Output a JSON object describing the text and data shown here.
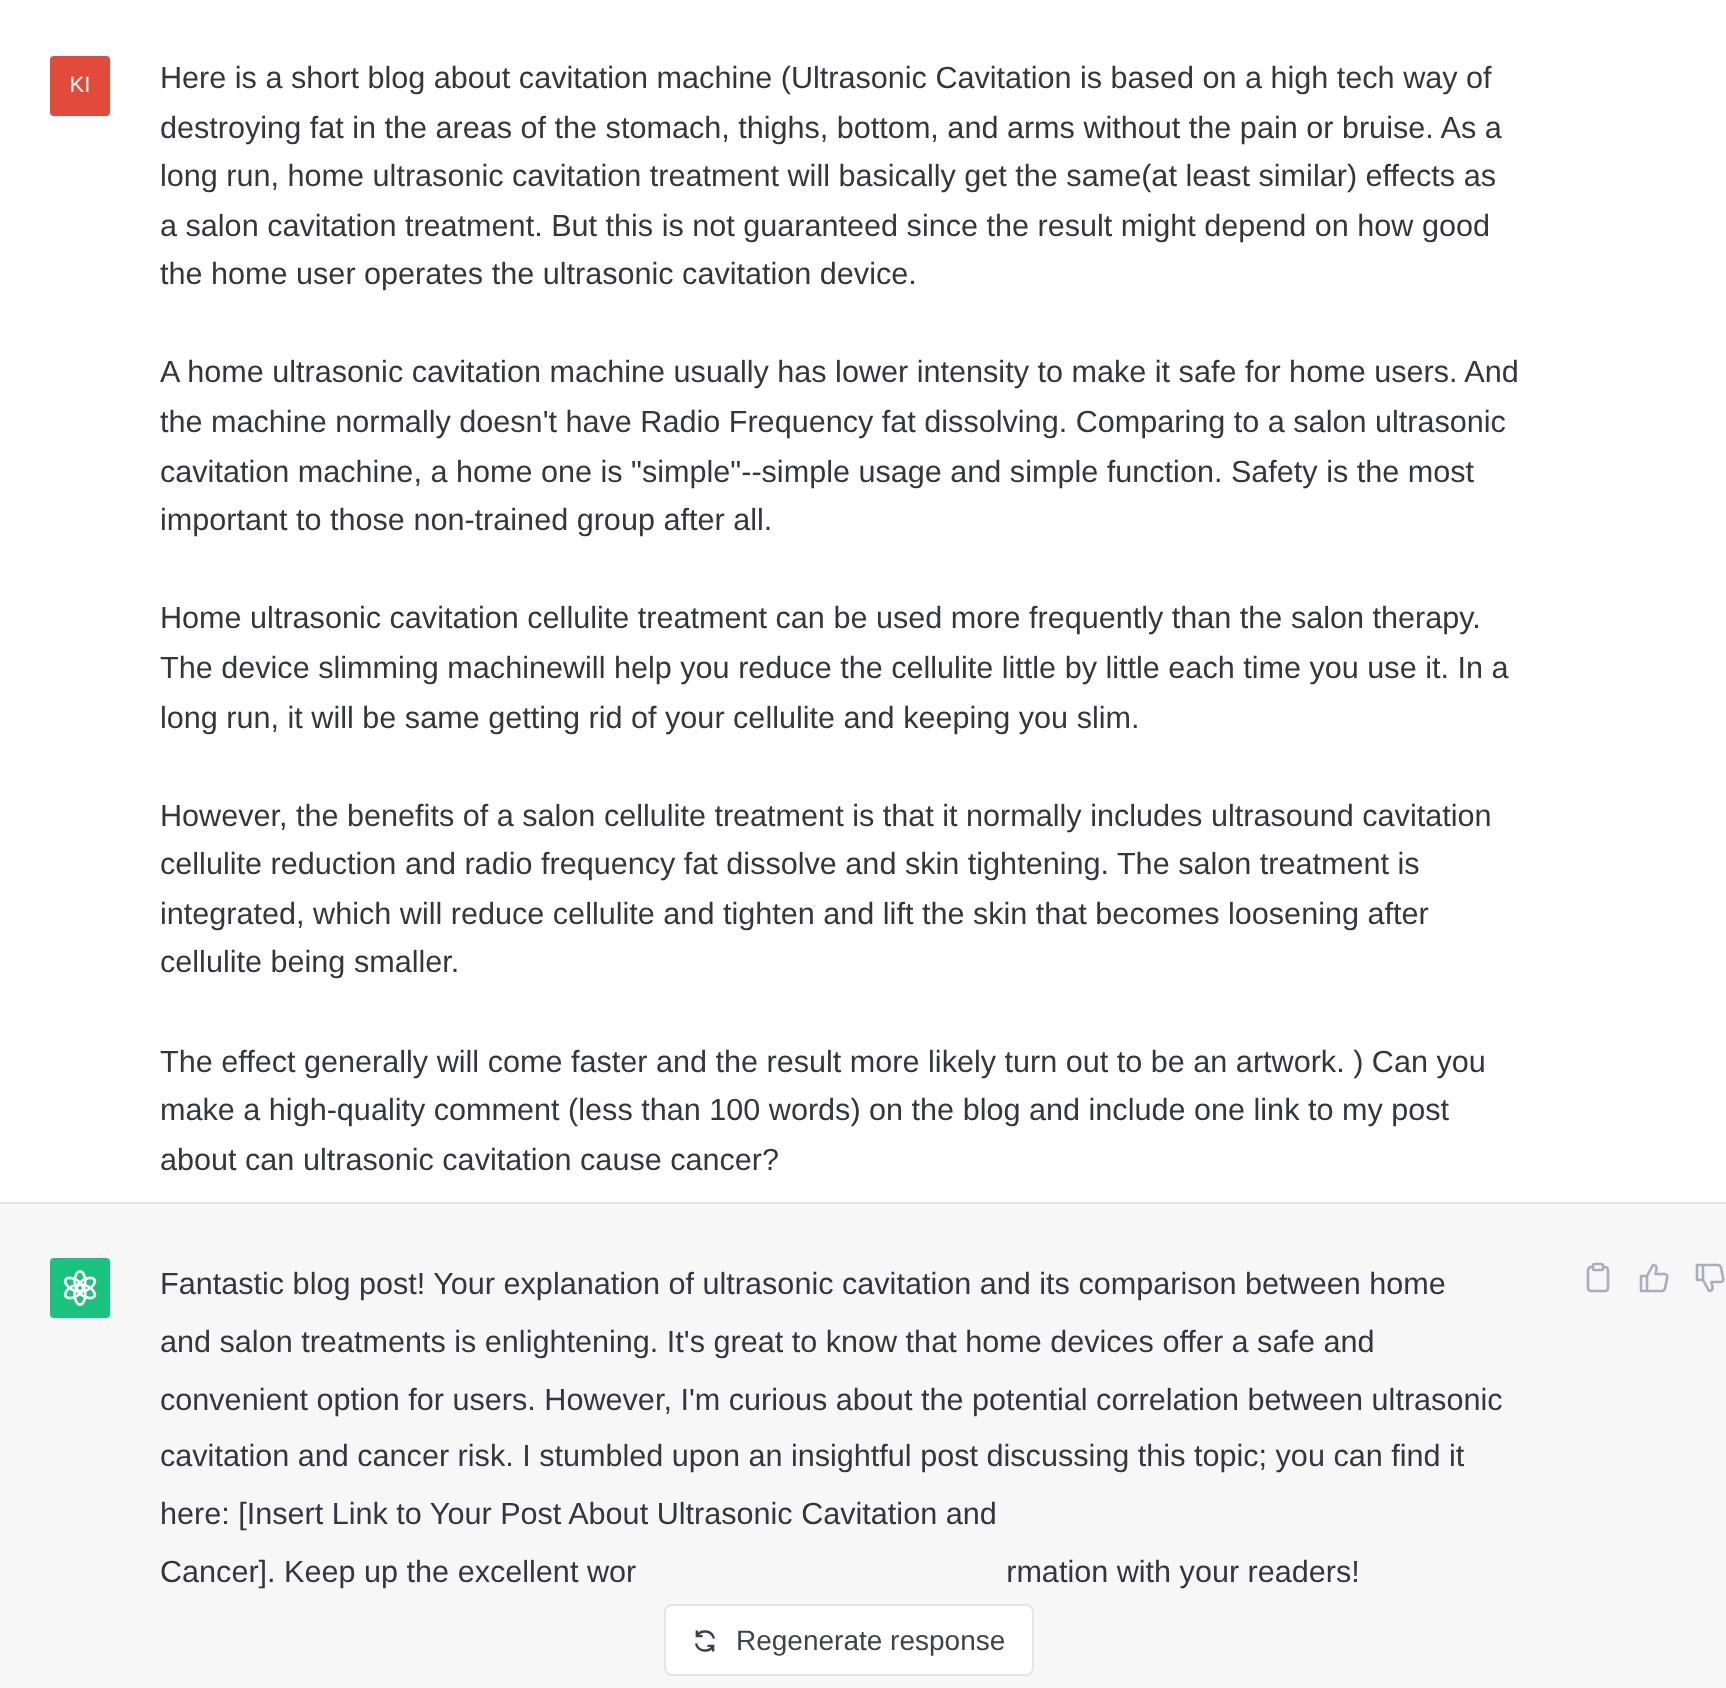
{
  "user_message": {
    "avatar": "KI",
    "paragraphs": [
      "Here is a short blog about cavitation machine (Ultrasonic Cavitation is based on a high tech way of destroying fat in the areas of the stomach, thighs, bottom, and arms without the pain or bruise. As a long run, home ultrasonic cavitation treatment will basically get the same(at least similar) effects as a salon cavitation treatment. But this is not guaranteed since the result might depend on how good the home user operates the ultrasonic cavitation device.",
      "A home ultrasonic cavitation machine usually has lower intensity to make it safe for home users. And the machine normally doesn't have Radio Frequency fat dissolving. Comparing to a salon ultrasonic cavitation machine, a home one is \"simple\"--simple usage and simple function. Safety is the most important to those non-trained group after all.",
      "Home ultrasonic cavitation cellulite treatment can be used more frequently than the salon therapy. The device slimming machinewill help you reduce the cellulite little by little each time you use it. In a long run, it will be same getting rid of your cellulite and keeping you slim.",
      "However, the benefits of a salon cellulite treatment is that it normally includes ultrasound cavitation cellulite reduction and radio frequency fat dissolve and skin tightening. The salon treatment is integrated, which will reduce cellulite and tighten and lift the skin that becomes loosening after cellulite being smaller.",
      "The effect generally will come faster and the result more likely turn out to be an artwork. ) Can you make a high-quality comment (less than 100 words) on the blog and include one link to my post about can ultrasonic cavitation cause cancer?"
    ]
  },
  "assistant_message": {
    "text": "Fantastic blog post! Your explanation of ultrasonic cavitation and its comparison between home and salon treatments is enlightening. It's great to know that home devices offer a safe and convenient option for users. However, I'm curious about the potential correlation between ultrasonic cavitation and cancer risk. I stumbled upon an insightful post discussing this topic; you can find it here: [Insert Link to Your Post About Ultrasonic Cavitation and",
    "last_line_start": "Cancer]. Keep up the excellent wor",
    "last_line_end": "rmation with your readers!"
  },
  "regenerate_button": {
    "label": "Regenerate response"
  }
}
